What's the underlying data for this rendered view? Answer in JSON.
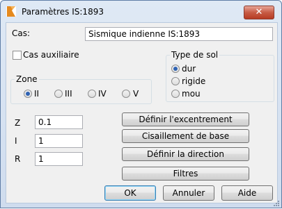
{
  "window": {
    "title": "Paramètres IS:1893",
    "close_symbol": "✕"
  },
  "cas": {
    "label": "Cas:",
    "value": "Sismique indienne IS:1893"
  },
  "cas_auxiliaire": {
    "label": "Cas auxiliaire",
    "checked": false
  },
  "zone": {
    "title": "Zone",
    "options": [
      "II",
      "III",
      "IV",
      "V"
    ],
    "selected": "II"
  },
  "type_de_sol": {
    "title": "Type de sol",
    "options": [
      "dur",
      "rigide",
      "mou"
    ],
    "selected": "dur"
  },
  "params": {
    "z": {
      "label": "Z",
      "value": "0.1"
    },
    "i": {
      "label": "I",
      "value": "1"
    },
    "r": {
      "label": "R",
      "value": "1"
    }
  },
  "buttons": {
    "excentrement": "Définir l'excentrement",
    "cisaillement": "Cisaillement de base",
    "direction": "Définir la direction",
    "filtres": "Filtres",
    "ok": "OK",
    "annuler": "Annuler",
    "aide": "Aide"
  },
  "colors": {
    "accent": "#2f63b3",
    "close": "#c75c45",
    "icon": "#e58a1f"
  }
}
